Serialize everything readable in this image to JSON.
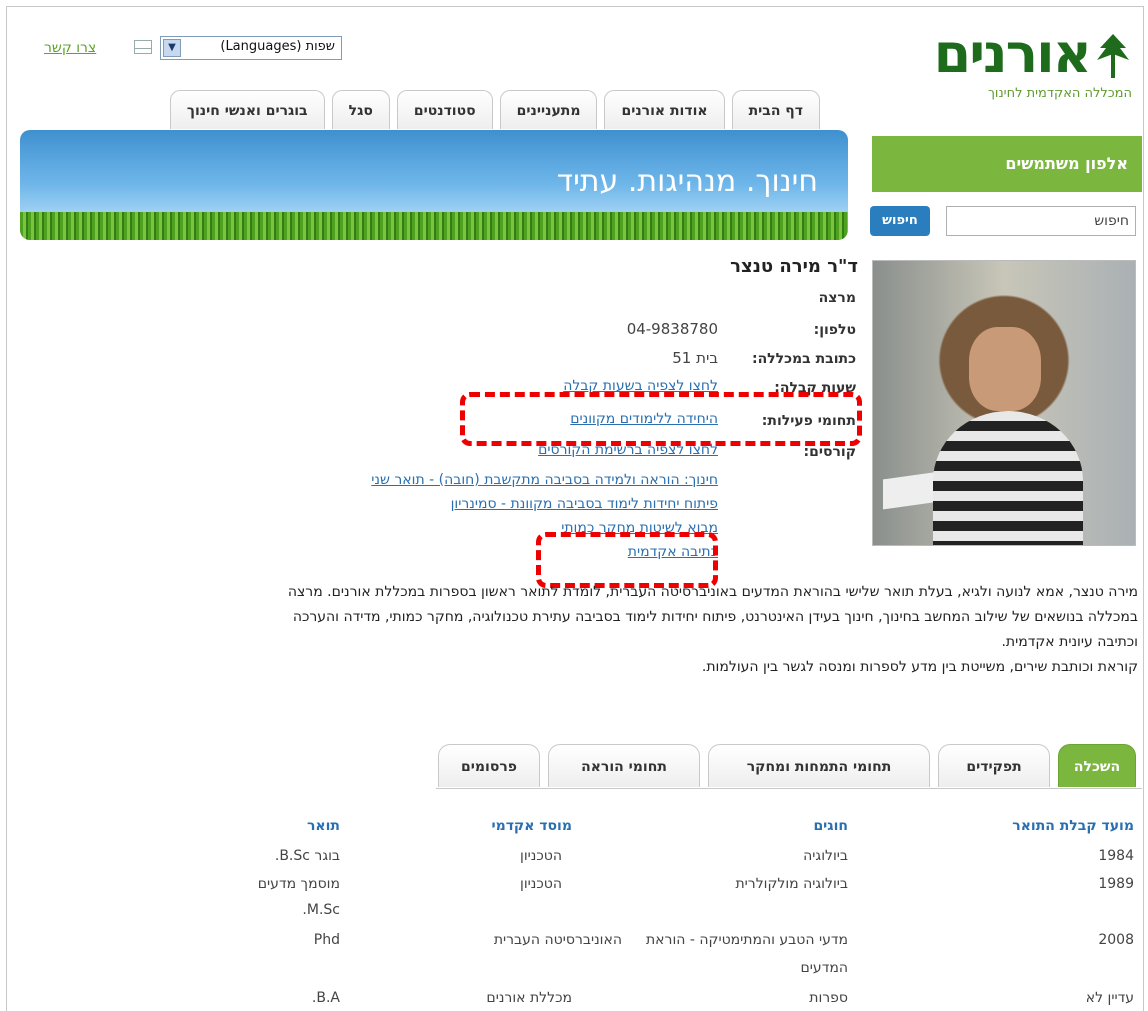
{
  "header": {
    "contact_label": "צרו קשר",
    "languages_label": "שפות (Languages)",
    "logo_title": "אורנים",
    "logo_subtitle": "המכללה האקדמית לחינוך"
  },
  "nav": {
    "tabs": [
      {
        "label": "דף הבית"
      },
      {
        "label": "אודות אורנים"
      },
      {
        "label": "מתעניינים"
      },
      {
        "label": "סטודנטים"
      },
      {
        "label": "סגל"
      },
      {
        "label": "בוגרים ואנשי חינוך"
      }
    ]
  },
  "banner": {
    "slogan": "חינוך. מנהיגות. עתיד"
  },
  "sidebar": {
    "title": "אלפון משתמשים",
    "search_placeholder": "חיפוש",
    "search_button": "חיפוש"
  },
  "profile": {
    "name": "ד\"ר מירה טנצר",
    "role": "מרצה",
    "phone_label": "טלפון:",
    "phone": "04-9838780",
    "address_label": "כתובת במכללה:",
    "address": "בית 51",
    "hours_label": "שעות קבלה:",
    "hours_link": "לחצו לצפיה בשעות קבלה",
    "activity_label": "תחומי פעילות:",
    "activity_link": "היחידה ללימודים מקוונים",
    "courses_label": "קורסים:",
    "courses": [
      "לחצו לצפיה ברשימת הקורסים",
      "חינוך: הוראה ולמידה בסביבה מתקשבת (חובה) - תואר שני",
      "פיתוח יחידות לימוד בסביבה מקוונת - סמינריון",
      "מבוא לשיטות מחקר כמותי",
      "כתיבה אקדמית"
    ],
    "bio": [
      "מירה טנצר, אמא לנועה ולגיא, בעלת תואר שלישי בהוראת המדעים באוניברסיטה העברית, לומדת לתואר ראשון בספרות במכללת אורנים. מרצה",
      "במכללה בנושאים של שילוב המחשב בחינוך, חינוך בעידן האינטרנט, פיתוח יחידות לימוד בסביבה עתירת טכנולוגיה, מחקר כמותי, מדידה והערכה",
      "וכתיבה עיונית אקדמית.",
      "קוראת וכותבת שירים, משייטת בין מדע לספרות ומנסה לגשר בין העולמות."
    ]
  },
  "info_tabs": [
    {
      "label": "השכלה"
    },
    {
      "label": "תפקידים"
    },
    {
      "label": "תחומי התמחות ומחקר"
    },
    {
      "label": "תחומי הוראה"
    },
    {
      "label": "פרסומים"
    }
  ],
  "education": {
    "headers": {
      "year": "מועד קבלת התואר",
      "field": "חוגים",
      "institution": "מוסד אקדמי",
      "degree": "תואר"
    },
    "rows": [
      {
        "year": "1984",
        "field": "ביולוגיה",
        "institution": "הטכניון",
        "degree": "בוגר B.Sc."
      },
      {
        "year": "1989",
        "field": "ביולוגיה מולקולרית",
        "institution": "הטכניון",
        "degree": "מוסמך מדעים",
        "degree2": "M.Sc."
      },
      {
        "year": "2008",
        "field": "מדעי הטבע והמתימטיקה - הוראת",
        "field2": "המדעים",
        "institution": "האוניברסיטה העברית",
        "degree": "Phd"
      },
      {
        "year": "עדיין לא",
        "field": "ספרות",
        "institution": "מכללת אורנים",
        "degree": "B.A."
      }
    ]
  }
}
